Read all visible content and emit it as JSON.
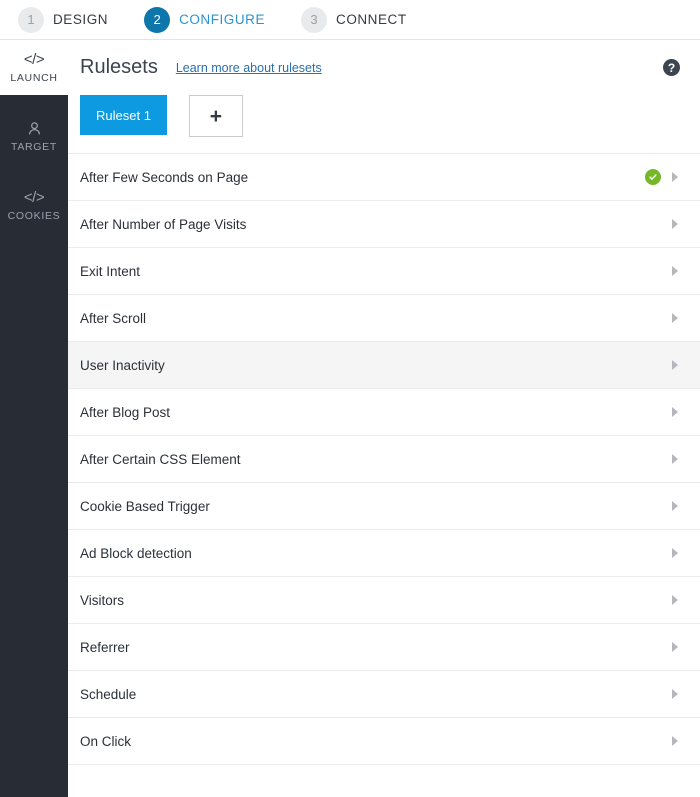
{
  "steps": [
    {
      "num": "1",
      "label": "DESIGN",
      "active": false
    },
    {
      "num": "2",
      "label": "CONFIGURE",
      "active": true
    },
    {
      "num": "3",
      "label": "CONNECT",
      "active": false
    }
  ],
  "sidebar": {
    "items": [
      {
        "label": "LAUNCH",
        "icon": "code-icon",
        "glyph": "</>",
        "active": true
      },
      {
        "label": "TARGET",
        "icon": "person-icon",
        "glyph": "",
        "active": false
      },
      {
        "label": "COOKIES",
        "icon": "code-icon",
        "glyph": "</>",
        "active": false
      }
    ]
  },
  "header": {
    "title": "Rulesets",
    "learn_more": "Learn more about rulesets",
    "help_icon": "question-mark-icon",
    "help_glyph": "?"
  },
  "tabs": {
    "ruleset_label": "Ruleset 1",
    "add_icon": "plus-icon",
    "add_glyph": "+"
  },
  "rules": [
    {
      "label": "After Few Seconds on Page",
      "enabled": true,
      "hovered": false
    },
    {
      "label": "After Number of Page Visits",
      "enabled": false,
      "hovered": false
    },
    {
      "label": "Exit Intent",
      "enabled": false,
      "hovered": false
    },
    {
      "label": "After Scroll",
      "enabled": false,
      "hovered": false
    },
    {
      "label": "User Inactivity",
      "enabled": false,
      "hovered": true
    },
    {
      "label": "After Blog Post",
      "enabled": false,
      "hovered": false
    },
    {
      "label": "After Certain CSS Element",
      "enabled": false,
      "hovered": false
    },
    {
      "label": "Cookie Based Trigger",
      "enabled": false,
      "hovered": false
    },
    {
      "label": "Ad Block detection",
      "enabled": false,
      "hovered": false
    },
    {
      "label": "Visitors",
      "enabled": false,
      "hovered": false
    },
    {
      "label": "Referrer",
      "enabled": false,
      "hovered": false
    },
    {
      "label": "Schedule",
      "enabled": false,
      "hovered": false
    },
    {
      "label": "On Click",
      "enabled": false,
      "hovered": false
    }
  ],
  "colors": {
    "step_active": "#0d76ab",
    "step_active_text": "#2a93d5",
    "tab_blue": "#0e9ae0",
    "link_blue": "#2a6fa8",
    "sidebar_bg": "#272c35",
    "enabled_green": "#76b72a",
    "row_hover": "#f5f5f5"
  }
}
